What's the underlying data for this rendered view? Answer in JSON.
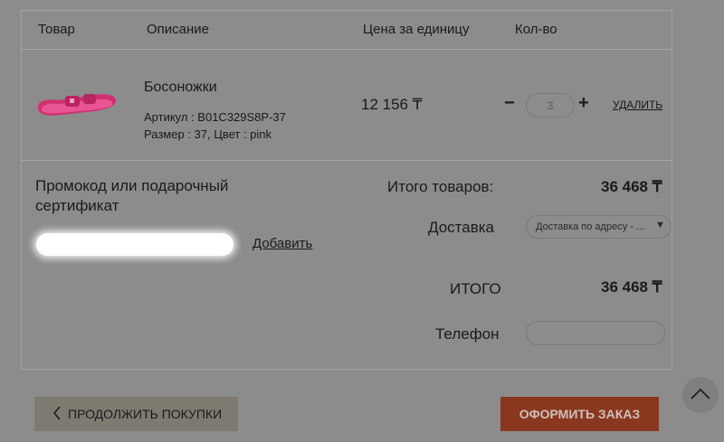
{
  "table_header": {
    "product": "Товар",
    "description": "Описание",
    "unit_price": "Цена за единицу",
    "quantity": "Кол-во"
  },
  "item": {
    "name": "Босоножки",
    "article": "Артикул : B01C329S8P-37",
    "details": "Размер : 37, Цвет : pink",
    "price": "12 156 ₸",
    "qty_minus": "−",
    "qty": "3",
    "qty_plus": "+",
    "remove": "УДАЛИТЬ",
    "product_color": "#e0307a"
  },
  "promo": {
    "title": "Промокод или подарочный сертификат",
    "value": "",
    "add": "Добавить"
  },
  "summary": {
    "goods_label": "Итого товаров:",
    "goods_value": "36 468 ₸",
    "delivery_label": "Доставка",
    "delivery_value": "Доставка по адресу - ...",
    "total_label": "ИТОГО",
    "total_value": "36 468 ₸",
    "phone_label": "Телефон",
    "phone_value": ""
  },
  "actions": {
    "continue": "ПРОДОЛЖИТЬ ПОКУПКИ",
    "order": "ОФОРМИТЬ ЗАКАЗ",
    "order_color": "#8a3720"
  },
  "icons": {
    "back": "chevron-left-icon",
    "scroll_top": "chevron-up-icon",
    "dropdown": "caret-down-icon"
  }
}
